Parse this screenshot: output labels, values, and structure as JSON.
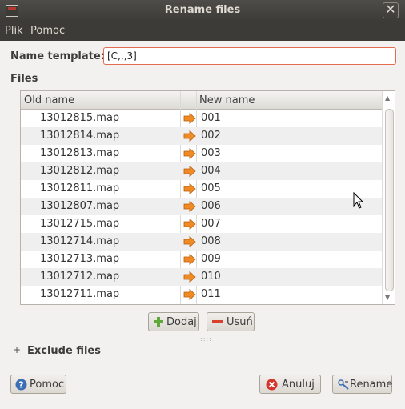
{
  "window": {
    "title": "Rename files"
  },
  "menu": {
    "items": [
      "Plik",
      "Pomoc"
    ]
  },
  "form": {
    "template_label": "Name template:",
    "template_value": "[C,,,3]",
    "files_label": "Files"
  },
  "table": {
    "columns": {
      "old": "Old name",
      "new": "New name"
    },
    "rows": [
      {
        "old": "13012815.map",
        "new": "001"
      },
      {
        "old": "13012814.map",
        "new": "002"
      },
      {
        "old": "13012813.map",
        "new": "003"
      },
      {
        "old": "13012812.map",
        "new": "004"
      },
      {
        "old": "13012811.map",
        "new": "005"
      },
      {
        "old": "13012807.map",
        "new": "006"
      },
      {
        "old": "13012715.map",
        "new": "007"
      },
      {
        "old": "13012714.map",
        "new": "008"
      },
      {
        "old": "13012713.map",
        "new": "009"
      },
      {
        "old": "13012712.map",
        "new": "010"
      },
      {
        "old": "13012711.map",
        "new": "011"
      }
    ]
  },
  "list_buttons": {
    "add": "Dodaj",
    "remove": "Usuń"
  },
  "exclude": {
    "label": "Exclude files"
  },
  "footer": {
    "help": "Pomoc",
    "cancel": "Anuluj",
    "rename": "Rename"
  },
  "colors": {
    "arrow": "#f08a24",
    "add_icon": "#5fa83a",
    "remove_icon": "#d8412f",
    "help_icon": "#3a6fb5",
    "cancel_icon": "#d5352a"
  }
}
